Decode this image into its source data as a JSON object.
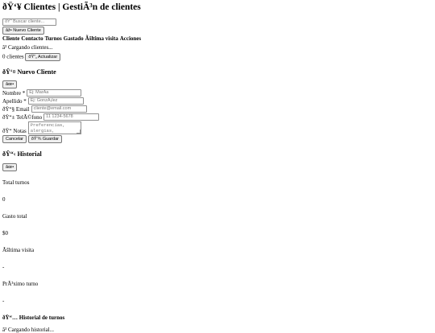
{
  "header": {
    "title": "ðŸ‘¥ Clientes | GestiÃ³n de clientes"
  },
  "search": {
    "placeholder": "ðŸ” Buscar cliente..."
  },
  "toolbar": {
    "new_client_label": "âž• Nuevo Cliente"
  },
  "table": {
    "headers": [
      "Cliente",
      "Contacto",
      "Turnos",
      "Gastado",
      "Ãšltima visita",
      "Acciones"
    ],
    "loading_text": "â³ Cargando clientes..."
  },
  "footer": {
    "count_text": "0 clientes",
    "refresh_label": "ðŸ”„ Actualizar"
  },
  "modal_new": {
    "title": "ðŸ‘¤ Nuevo Cliente",
    "close_label": "âœ•",
    "fields": {
      "nombre_label": "Nombre *",
      "nombre_placeholder": "Ej: MarÃ­a",
      "apellido_label": "Apellido *",
      "apellido_placeholder": "Ej: GonzÃ¡lez",
      "email_label": "ðŸ“§ Email",
      "email_placeholder": "cliente@email.com",
      "telefono_label": "ðŸ“± TelÃ©fono",
      "telefono_placeholder": "11 1234-5678",
      "notas_label": "ðŸ“ Notas",
      "notas_placeholder_line1": "Preferencias,",
      "notas_placeholder_line2": "alergias,"
    },
    "cancel_label": "Cancelar",
    "save_label": "ðŸ’¾ Guardar"
  },
  "modal_history": {
    "title": "ðŸ“‹ Historial",
    "close_label": "âœ•",
    "stats": {
      "total_turnos_label": "Total turnos",
      "total_turnos_value": "0",
      "gasto_total_label": "Gasto total",
      "gasto_total_value": "$0",
      "ultima_visita_label": "Ãšltima visita",
      "ultima_visita_value": "-",
      "proximo_turno_label": "PrÃ³ximo turno",
      "proximo_turno_value": "-"
    },
    "history_title": "ðŸ“… Historial de turnos",
    "loading_text": "â³ Cargando historial..."
  }
}
